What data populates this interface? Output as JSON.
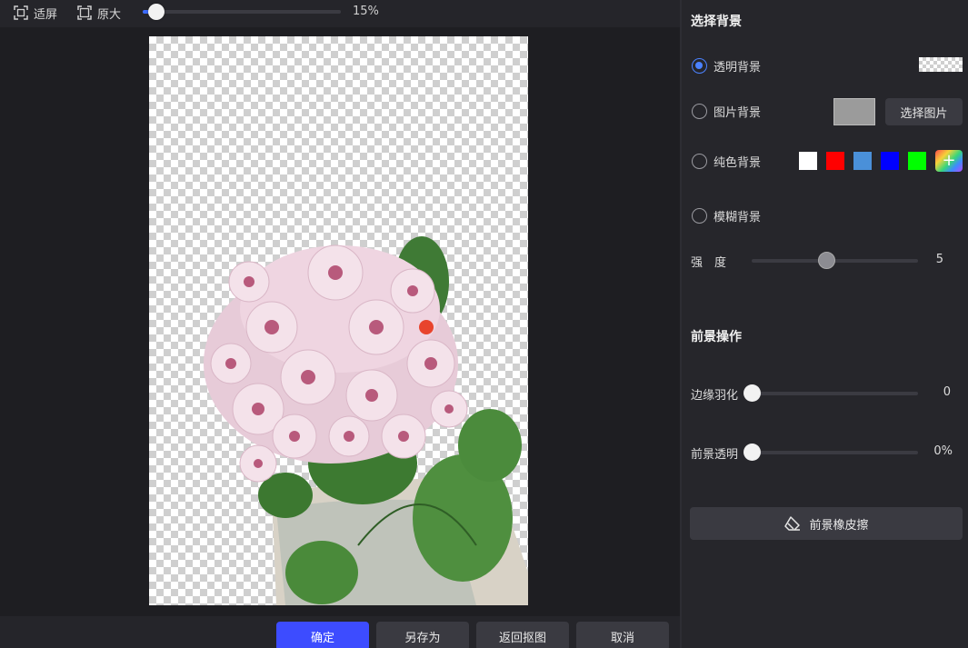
{
  "toolbar": {
    "fit_label": "适屏",
    "original_label": "原大",
    "zoom": {
      "value_text": "15%",
      "fraction": 0.07
    }
  },
  "actions": {
    "confirm": "确定",
    "save_as": "另存为",
    "back_to_cutout": "返回抠图",
    "cancel": "取消"
  },
  "background": {
    "title": "选择背景",
    "options": [
      {
        "label": "透明背景",
        "checked": true
      },
      {
        "label": "图片背景",
        "checked": false
      },
      {
        "label": "纯色背景",
        "checked": false
      },
      {
        "label": "模糊背景",
        "checked": false
      }
    ],
    "choose_image_label": "选择图片",
    "colors": [
      "#ffffff",
      "#ff0000",
      "#4a90d9",
      "#0000ff",
      "#00ff00"
    ],
    "strength": {
      "label": "强　度",
      "value": 5,
      "fraction": 0.45
    }
  },
  "foreground": {
    "title": "前景操作",
    "feather": {
      "label": "边缘羽化",
      "value": "0",
      "fraction": 0
    },
    "opacity": {
      "label": "前景透明",
      "value": "0%",
      "fraction": 0
    },
    "eraser_label": "前景橡皮擦"
  },
  "accent_color": "#3d4cff"
}
